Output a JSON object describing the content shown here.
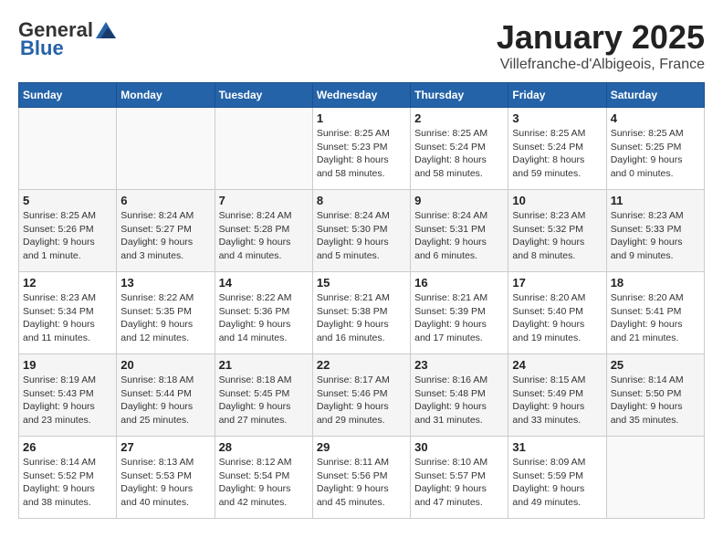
{
  "logo": {
    "general": "General",
    "blue": "Blue"
  },
  "title": "January 2025",
  "location": "Villefranche-d'Albigeois, France",
  "weekdays": [
    "Sunday",
    "Monday",
    "Tuesday",
    "Wednesday",
    "Thursday",
    "Friday",
    "Saturday"
  ],
  "weeks": [
    [
      {
        "day": "",
        "info": ""
      },
      {
        "day": "",
        "info": ""
      },
      {
        "day": "",
        "info": ""
      },
      {
        "day": "1",
        "info": "Sunrise: 8:25 AM\nSunset: 5:23 PM\nDaylight: 8 hours\nand 58 minutes."
      },
      {
        "day": "2",
        "info": "Sunrise: 8:25 AM\nSunset: 5:24 PM\nDaylight: 8 hours\nand 58 minutes."
      },
      {
        "day": "3",
        "info": "Sunrise: 8:25 AM\nSunset: 5:24 PM\nDaylight: 8 hours\nand 59 minutes."
      },
      {
        "day": "4",
        "info": "Sunrise: 8:25 AM\nSunset: 5:25 PM\nDaylight: 9 hours\nand 0 minutes."
      }
    ],
    [
      {
        "day": "5",
        "info": "Sunrise: 8:25 AM\nSunset: 5:26 PM\nDaylight: 9 hours\nand 1 minute."
      },
      {
        "day": "6",
        "info": "Sunrise: 8:24 AM\nSunset: 5:27 PM\nDaylight: 9 hours\nand 3 minutes."
      },
      {
        "day": "7",
        "info": "Sunrise: 8:24 AM\nSunset: 5:28 PM\nDaylight: 9 hours\nand 4 minutes."
      },
      {
        "day": "8",
        "info": "Sunrise: 8:24 AM\nSunset: 5:30 PM\nDaylight: 9 hours\nand 5 minutes."
      },
      {
        "day": "9",
        "info": "Sunrise: 8:24 AM\nSunset: 5:31 PM\nDaylight: 9 hours\nand 6 minutes."
      },
      {
        "day": "10",
        "info": "Sunrise: 8:23 AM\nSunset: 5:32 PM\nDaylight: 9 hours\nand 8 minutes."
      },
      {
        "day": "11",
        "info": "Sunrise: 8:23 AM\nSunset: 5:33 PM\nDaylight: 9 hours\nand 9 minutes."
      }
    ],
    [
      {
        "day": "12",
        "info": "Sunrise: 8:23 AM\nSunset: 5:34 PM\nDaylight: 9 hours\nand 11 minutes."
      },
      {
        "day": "13",
        "info": "Sunrise: 8:22 AM\nSunset: 5:35 PM\nDaylight: 9 hours\nand 12 minutes."
      },
      {
        "day": "14",
        "info": "Sunrise: 8:22 AM\nSunset: 5:36 PM\nDaylight: 9 hours\nand 14 minutes."
      },
      {
        "day": "15",
        "info": "Sunrise: 8:21 AM\nSunset: 5:38 PM\nDaylight: 9 hours\nand 16 minutes."
      },
      {
        "day": "16",
        "info": "Sunrise: 8:21 AM\nSunset: 5:39 PM\nDaylight: 9 hours\nand 17 minutes."
      },
      {
        "day": "17",
        "info": "Sunrise: 8:20 AM\nSunset: 5:40 PM\nDaylight: 9 hours\nand 19 minutes."
      },
      {
        "day": "18",
        "info": "Sunrise: 8:20 AM\nSunset: 5:41 PM\nDaylight: 9 hours\nand 21 minutes."
      }
    ],
    [
      {
        "day": "19",
        "info": "Sunrise: 8:19 AM\nSunset: 5:43 PM\nDaylight: 9 hours\nand 23 minutes."
      },
      {
        "day": "20",
        "info": "Sunrise: 8:18 AM\nSunset: 5:44 PM\nDaylight: 9 hours\nand 25 minutes."
      },
      {
        "day": "21",
        "info": "Sunrise: 8:18 AM\nSunset: 5:45 PM\nDaylight: 9 hours\nand 27 minutes."
      },
      {
        "day": "22",
        "info": "Sunrise: 8:17 AM\nSunset: 5:46 PM\nDaylight: 9 hours\nand 29 minutes."
      },
      {
        "day": "23",
        "info": "Sunrise: 8:16 AM\nSunset: 5:48 PM\nDaylight: 9 hours\nand 31 minutes."
      },
      {
        "day": "24",
        "info": "Sunrise: 8:15 AM\nSunset: 5:49 PM\nDaylight: 9 hours\nand 33 minutes."
      },
      {
        "day": "25",
        "info": "Sunrise: 8:14 AM\nSunset: 5:50 PM\nDaylight: 9 hours\nand 35 minutes."
      }
    ],
    [
      {
        "day": "26",
        "info": "Sunrise: 8:14 AM\nSunset: 5:52 PM\nDaylight: 9 hours\nand 38 minutes."
      },
      {
        "day": "27",
        "info": "Sunrise: 8:13 AM\nSunset: 5:53 PM\nDaylight: 9 hours\nand 40 minutes."
      },
      {
        "day": "28",
        "info": "Sunrise: 8:12 AM\nSunset: 5:54 PM\nDaylight: 9 hours\nand 42 minutes."
      },
      {
        "day": "29",
        "info": "Sunrise: 8:11 AM\nSunset: 5:56 PM\nDaylight: 9 hours\nand 45 minutes."
      },
      {
        "day": "30",
        "info": "Sunrise: 8:10 AM\nSunset: 5:57 PM\nDaylight: 9 hours\nand 47 minutes."
      },
      {
        "day": "31",
        "info": "Sunrise: 8:09 AM\nSunset: 5:59 PM\nDaylight: 9 hours\nand 49 minutes."
      },
      {
        "day": "",
        "info": ""
      }
    ]
  ]
}
